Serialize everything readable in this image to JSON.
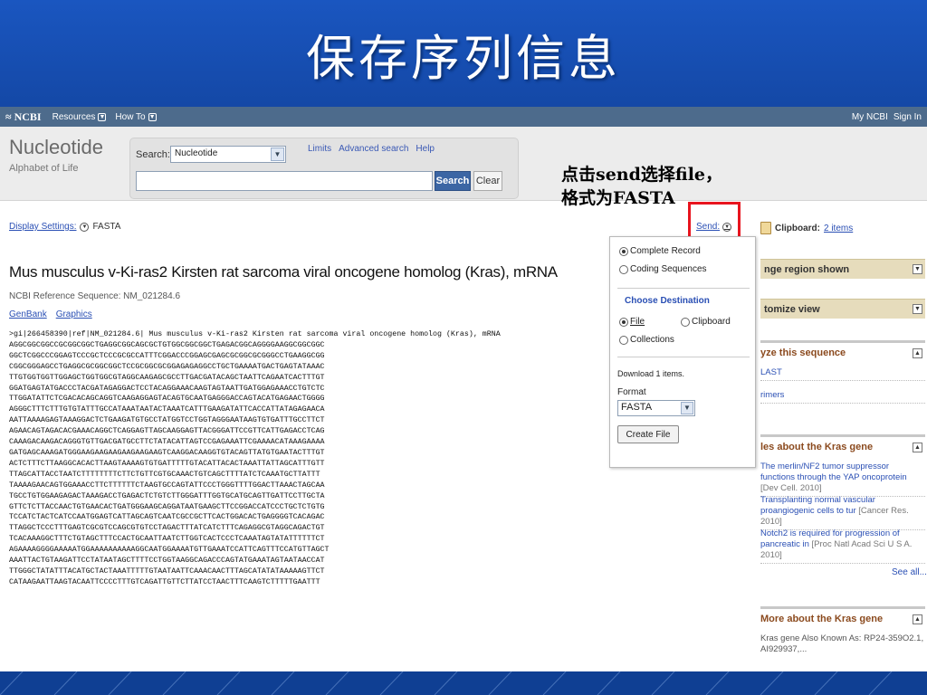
{
  "slide": {
    "title": "保存序列信息"
  },
  "ncbi": {
    "logo": "NCBI",
    "menu": [
      "Resources",
      "How To"
    ],
    "right": [
      "My NCBI",
      "Sign In"
    ]
  },
  "header": {
    "db_name": "Nucleotide",
    "db_sub": "Alphabet of Life",
    "search_label": "Search:",
    "search_db": "Nucleotide",
    "links": [
      "Limits",
      "Advanced search",
      "Help"
    ],
    "search_value": "",
    "search_button": "Search",
    "clear_button": "Clear"
  },
  "annotation": {
    "line1": "点击send选择file，",
    "line2": "格式为FASTA"
  },
  "display": {
    "label": "Display Settings:",
    "value": "FASTA"
  },
  "record": {
    "title": "Mus musculus v-Ki-ras2 Kirsten rat sarcoma viral oncogene homolog (Kras), mRNA",
    "meta": "NCBI Reference Sequence: NM_021284.6",
    "links": [
      "GenBank",
      "Graphics"
    ],
    "sequence": [
      ">gi|266458390|ref|NM_021284.6| Mus musculus v-Ki-ras2 Kirsten rat sarcoma viral oncogene homolog (Kras), mRNA",
      "AGGCGGCGGCCGCGGCGGCTGAGGCGGCAGCGCTGTGGCGGCGGCTGAGACGGCAGGGGAAGGCGGCGGC",
      "GGCTCGGCCCGGAGTCCCGCTCCCGCGCCATTTCGGACCCGGAGCGAGCGCGGCGCGGGCCTGAAGGCGG",
      "CGGCGGGAGCCTGAGGCGCGGCGGCTCCGCGGCGCGGAGAGAGGCCTGCTGAAAATGACTGAGTATAAAC",
      "TTGTGGTGGTTGGAGCTGGTGGCGTAGGCAAGAGCGCCTTGACGATACAGCTAATTCAGAATCACTTTGT",
      "GGATGAGTATGACCCTACGATAGAGGACTCCTACAGGAAACAAGTAGTAATTGATGGAGAAACCTGTCTC",
      "TTGGATATTCTCGACACAGCAGGTCAAGAGGAGTACAGTGCAATGAGGGACCAGTACATGAGAACTGGGG",
      "AGGGCTTTCTTTGTGTATTTGCCATAAATAATACTAAATCATTTGAAGATATTCACCATTATAGAGAACA",
      "AATTAAAAGAGTAAAGGACTCTGAAGATGTGCCTATGGTCCTGGTAGGGAATAAGTGTGATTTGCCTTCT",
      "AGAACAGTAGACACGAAACAGGCTCAGGAGTTAGCAAGGAGTTACGGGATTCCGTTCATTGAGACCTCAG",
      "CAAAGACAAGACAGGGTGTTGACGATGCCTTCTATACATTAGTCCGAGAAATTCGAAAACATAAAGAAAA",
      "GATGAGCAAAGATGGGAAGAAGAAGAAGAAGAAGTCAAGGACAAGGTGTACAGTTATGTGAATACTTTGT",
      "ACTCTTTCTTAAGGCACACTTAAGTAAAAGTGTGATTTTTGTACATTACACTAAATTATTAGCATTTGTT",
      "TTAGCATTACCTAATCTTTTTTTTCTTCTGTTCGTGCAAACTGTCAGCTTTTATCTCAAATGCTTATTT",
      "TAAAAGAACAGTGGAAACCTTCTTTTTTCTAAGTGCCAGTATTCCCTGGGTTTTGGACTTAAACTAGCAA",
      "TGCCTGTGGAAGAGACTAAAGACCTGAGACTCTGTCTTGGGATTTGGTGCATGCAGTTGATTCCTTGCTA",
      "GTTCTCTTACCAACTGTGAACACTGATGGGAAGCAGGATAATGAAGCTTCCGGACCATCCCTGCTCTGTG",
      "TCCATCTACTCATCCAATGGAGTCATTAGCAGTCAATCGCCGCTTCACTGGACACTGAGGGGTCACAGAC",
      "TTAGGCTCCCTTTGAGTCGCGTCCAGCGTGTCCTAGACTTTATCATCTTTCAGAGGCGTAGGCAGACTGT",
      "TCACAAAGGCTTTCTGTAGCTTTCCACTGCAATTAATCTTGGTCACTCCCTCAAATAGTATATTTTTTCT",
      "AGAAAAGGGGAAAAATGGAAAAAAAAAAGGCAATGGAAAATGTTGAAATCCATTCAGTTTCCATGTTAGCT",
      "AAATTACTGTAAGATTCCTATAATAGCTTTTCCTGGTAAGGCAGACCCAGTATGAAATAGTAATAACCAT",
      "TTGGGCTATATTTACATGCTACTAAATTTTTGTAATAATTCAAACAACTTTAGCATATATAAAAAGTTCT",
      "CATAAGAATTAAGTACAATTCCCCTTTGTCAGATTGTTCTTATCCTAACTTTCAAGTCTTTTTGAATTT"
    ]
  },
  "send": {
    "label": "Send:"
  },
  "popup": {
    "opt_complete": "Complete Record",
    "opt_coding": "Coding Sequences",
    "choose_dest": "Choose Destination",
    "opt_file": "File",
    "opt_clipboard": "Clipboard",
    "opt_collections": "Collections",
    "download_text": "Download 1 items.",
    "format_label": "Format",
    "format_value": "FASTA",
    "create_button": "Create File"
  },
  "sidebar": {
    "clipboard_label": "Clipboard:",
    "clipboard_link": "2 items",
    "change_region": "nge region shown",
    "customize": "tomize view",
    "analyze_head": "yze this sequence",
    "analyze_items": [
      "LAST",
      "rimers"
    ],
    "articles_head": "les about the Kras gene",
    "articles": [
      {
        "title": "The merlin/NF2 tumor suppressor functions through the YAP oncoprotein",
        "src": "[Dev Cell. 2010]"
      },
      {
        "title": "Transplanting normal vascular proangiogenic cells to tur",
        "src": "[Cancer Res. 2010]"
      },
      {
        "title": "Notch2 is required for progression of pancreatic in",
        "src": "[Proc Natl Acad Sci U S A. 2010]"
      }
    ],
    "see_all": "See all...",
    "more_head": "More about the Kras gene",
    "more_text": "Kras gene Also Known As: RP24-359O2.1, AI929937,..."
  },
  "colors": {
    "slide_bg": "#1a4ea8",
    "highlight": "#e8141e",
    "link": "#2a4fb4",
    "ncbi_bar": "#4d6b8c"
  }
}
